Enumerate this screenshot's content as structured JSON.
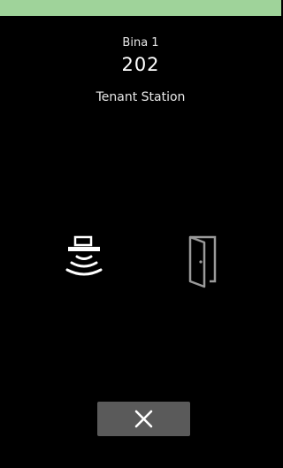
{
  "header": {
    "building": "Bina 1",
    "unit": "202",
    "station": "Tenant Station"
  },
  "actions": {
    "speaker_icon": "speaker-icon",
    "door_icon": "door-open-icon",
    "close_icon": "close-icon"
  },
  "colors": {
    "status_bar": "#9fd39a",
    "background": "#000000",
    "button": "#5a5a5a",
    "icon_light": "#ffffff",
    "icon_muted": "#9a9a9a"
  }
}
